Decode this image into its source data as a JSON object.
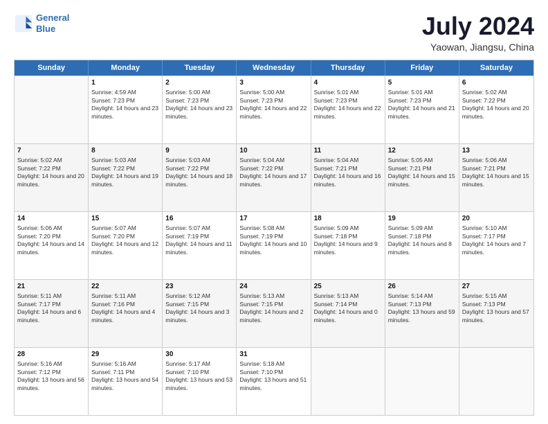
{
  "header": {
    "logo_line1": "General",
    "logo_line2": "Blue",
    "title": "July 2024",
    "subtitle": "Yaowan, Jiangsu, China"
  },
  "weekdays": [
    "Sunday",
    "Monday",
    "Tuesday",
    "Wednesday",
    "Thursday",
    "Friday",
    "Saturday"
  ],
  "weeks": [
    [
      {
        "day": "",
        "empty": true
      },
      {
        "day": "1",
        "sunrise": "Sunrise: 4:59 AM",
        "sunset": "Sunset: 7:23 PM",
        "daylight": "Daylight: 14 hours and 23 minutes."
      },
      {
        "day": "2",
        "sunrise": "Sunrise: 5:00 AM",
        "sunset": "Sunset: 7:23 PM",
        "daylight": "Daylight: 14 hours and 23 minutes."
      },
      {
        "day": "3",
        "sunrise": "Sunrise: 5:00 AM",
        "sunset": "Sunset: 7:23 PM",
        "daylight": "Daylight: 14 hours and 22 minutes."
      },
      {
        "day": "4",
        "sunrise": "Sunrise: 5:01 AM",
        "sunset": "Sunset: 7:23 PM",
        "daylight": "Daylight: 14 hours and 22 minutes."
      },
      {
        "day": "5",
        "sunrise": "Sunrise: 5:01 AM",
        "sunset": "Sunset: 7:23 PM",
        "daylight": "Daylight: 14 hours and 21 minutes."
      },
      {
        "day": "6",
        "sunrise": "Sunrise: 5:02 AM",
        "sunset": "Sunset: 7:22 PM",
        "daylight": "Daylight: 14 hours and 20 minutes."
      }
    ],
    [
      {
        "day": "7",
        "sunrise": "Sunrise: 5:02 AM",
        "sunset": "Sunset: 7:22 PM",
        "daylight": "Daylight: 14 hours and 20 minutes."
      },
      {
        "day": "8",
        "sunrise": "Sunrise: 5:03 AM",
        "sunset": "Sunset: 7:22 PM",
        "daylight": "Daylight: 14 hours and 19 minutes."
      },
      {
        "day": "9",
        "sunrise": "Sunrise: 5:03 AM",
        "sunset": "Sunset: 7:22 PM",
        "daylight": "Daylight: 14 hours and 18 minutes."
      },
      {
        "day": "10",
        "sunrise": "Sunrise: 5:04 AM",
        "sunset": "Sunset: 7:22 PM",
        "daylight": "Daylight: 14 hours and 17 minutes."
      },
      {
        "day": "11",
        "sunrise": "Sunrise: 5:04 AM",
        "sunset": "Sunset: 7:21 PM",
        "daylight": "Daylight: 14 hours and 16 minutes."
      },
      {
        "day": "12",
        "sunrise": "Sunrise: 5:05 AM",
        "sunset": "Sunset: 7:21 PM",
        "daylight": "Daylight: 14 hours and 15 minutes."
      },
      {
        "day": "13",
        "sunrise": "Sunrise: 5:06 AM",
        "sunset": "Sunset: 7:21 PM",
        "daylight": "Daylight: 14 hours and 15 minutes."
      }
    ],
    [
      {
        "day": "14",
        "sunrise": "Sunrise: 5:06 AM",
        "sunset": "Sunset: 7:20 PM",
        "daylight": "Daylight: 14 hours and 14 minutes."
      },
      {
        "day": "15",
        "sunrise": "Sunrise: 5:07 AM",
        "sunset": "Sunset: 7:20 PM",
        "daylight": "Daylight: 14 hours and 12 minutes."
      },
      {
        "day": "16",
        "sunrise": "Sunrise: 5:07 AM",
        "sunset": "Sunset: 7:19 PM",
        "daylight": "Daylight: 14 hours and 11 minutes."
      },
      {
        "day": "17",
        "sunrise": "Sunrise: 5:08 AM",
        "sunset": "Sunset: 7:19 PM",
        "daylight": "Daylight: 14 hours and 10 minutes."
      },
      {
        "day": "18",
        "sunrise": "Sunrise: 5:09 AM",
        "sunset": "Sunset: 7:18 PM",
        "daylight": "Daylight: 14 hours and 9 minutes."
      },
      {
        "day": "19",
        "sunrise": "Sunrise: 5:09 AM",
        "sunset": "Sunset: 7:18 PM",
        "daylight": "Daylight: 14 hours and 8 minutes."
      },
      {
        "day": "20",
        "sunrise": "Sunrise: 5:10 AM",
        "sunset": "Sunset: 7:17 PM",
        "daylight": "Daylight: 14 hours and 7 minutes."
      }
    ],
    [
      {
        "day": "21",
        "sunrise": "Sunrise: 5:11 AM",
        "sunset": "Sunset: 7:17 PM",
        "daylight": "Daylight: 14 hours and 6 minutes."
      },
      {
        "day": "22",
        "sunrise": "Sunrise: 5:11 AM",
        "sunset": "Sunset: 7:16 PM",
        "daylight": "Daylight: 14 hours and 4 minutes."
      },
      {
        "day": "23",
        "sunrise": "Sunrise: 5:12 AM",
        "sunset": "Sunset: 7:15 PM",
        "daylight": "Daylight: 14 hours and 3 minutes."
      },
      {
        "day": "24",
        "sunrise": "Sunrise: 5:13 AM",
        "sunset": "Sunset: 7:15 PM",
        "daylight": "Daylight: 14 hours and 2 minutes."
      },
      {
        "day": "25",
        "sunrise": "Sunrise: 5:13 AM",
        "sunset": "Sunset: 7:14 PM",
        "daylight": "Daylight: 14 hours and 0 minutes."
      },
      {
        "day": "26",
        "sunrise": "Sunrise: 5:14 AM",
        "sunset": "Sunset: 7:13 PM",
        "daylight": "Daylight: 13 hours and 59 minutes."
      },
      {
        "day": "27",
        "sunrise": "Sunrise: 5:15 AM",
        "sunset": "Sunset: 7:13 PM",
        "daylight": "Daylight: 13 hours and 57 minutes."
      }
    ],
    [
      {
        "day": "28",
        "sunrise": "Sunrise: 5:16 AM",
        "sunset": "Sunset: 7:12 PM",
        "daylight": "Daylight: 13 hours and 56 minutes."
      },
      {
        "day": "29",
        "sunrise": "Sunrise: 5:16 AM",
        "sunset": "Sunset: 7:11 PM",
        "daylight": "Daylight: 13 hours and 54 minutes."
      },
      {
        "day": "30",
        "sunrise": "Sunrise: 5:17 AM",
        "sunset": "Sunset: 7:10 PM",
        "daylight": "Daylight: 13 hours and 53 minutes."
      },
      {
        "day": "31",
        "sunrise": "Sunrise: 5:18 AM",
        "sunset": "Sunset: 7:10 PM",
        "daylight": "Daylight: 13 hours and 51 minutes."
      },
      {
        "day": "",
        "empty": true
      },
      {
        "day": "",
        "empty": true
      },
      {
        "day": "",
        "empty": true
      }
    ]
  ]
}
